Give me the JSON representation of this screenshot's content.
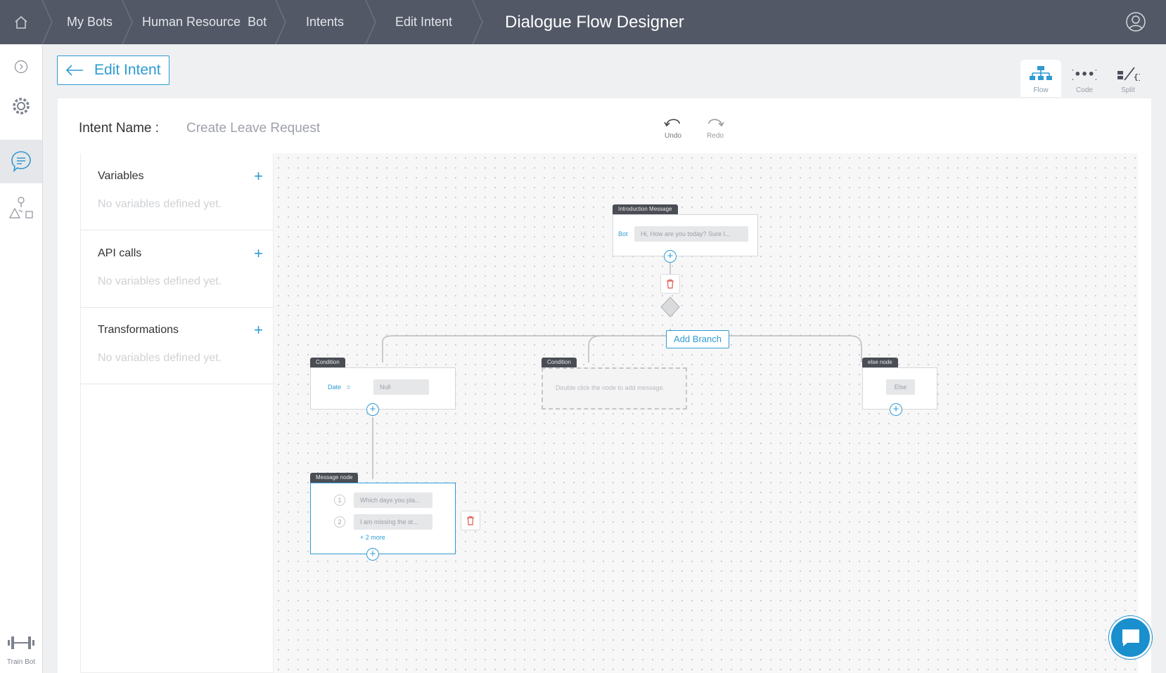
{
  "topbar": {
    "breadcrumbs": [
      "My Bots",
      "Human Resource  Bot",
      "Intents",
      "Edit Intent"
    ],
    "title": "Dialogue Flow Designer"
  },
  "sidebar": {
    "train_label": "Train Bot"
  },
  "header": {
    "edit_intent_label": "Edit Intent",
    "views": [
      "Flow",
      "Code",
      "Split"
    ]
  },
  "intent": {
    "label": "Intent Name :",
    "value": "Create Leave Request"
  },
  "history": {
    "undo": "Undo",
    "redo": "Redo"
  },
  "panel": {
    "sections": [
      {
        "title": "Variables",
        "empty": "No variables defined yet."
      },
      {
        "title": "API calls",
        "empty": "No variables defined yet."
      },
      {
        "title": "Transformations",
        "empty": "No variables defined yet."
      }
    ]
  },
  "flow": {
    "intro": {
      "tag": "Introduction Message",
      "speaker": "Bot",
      "message": "Hi, How are you today? Sure I..."
    },
    "add_branch": "Add Branch",
    "condition1": {
      "tag": "Condition",
      "variable": "Date",
      "operator": "=",
      "value": "Null"
    },
    "condition2": {
      "tag": "Condition",
      "placeholder": "Double click the node to add message."
    },
    "else_node": {
      "tag": "else node",
      "value": "Else"
    },
    "message_node": {
      "tag": "Message node",
      "items": [
        {
          "num": "1",
          "text": "Which days you pla..."
        },
        {
          "num": "2",
          "text": "I am missing the st..."
        }
      ],
      "more": "+ 2 more"
    }
  },
  "colors": {
    "accent": "#2f9bd2",
    "topbar": "#525866",
    "danger": "#e2574c"
  }
}
